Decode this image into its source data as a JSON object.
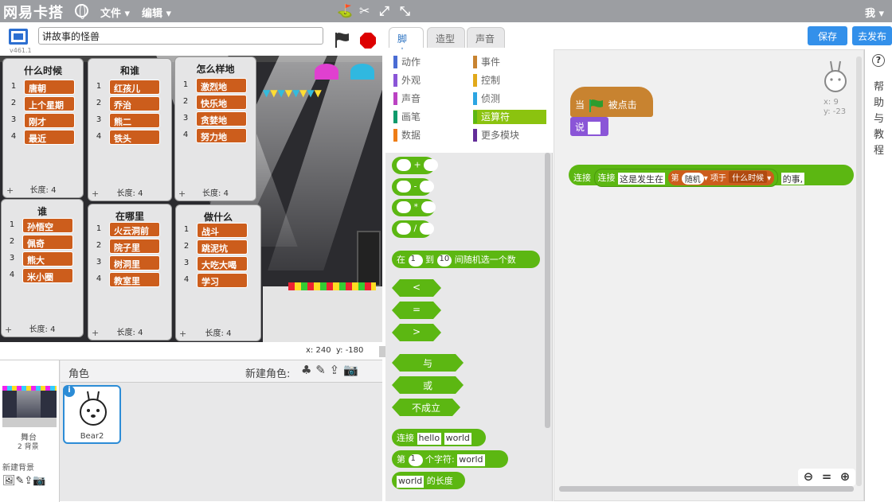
{
  "app": {
    "logo": "网易卡搭",
    "menu_file": "文件",
    "menu_edit": "编辑",
    "user": "我"
  },
  "stage": {
    "version": "v461.1",
    "project_title": "讲故事的怪兽",
    "coords_x_label": "x:",
    "coords_x": "240",
    "coords_y_label": "y:",
    "coords_y": "-180"
  },
  "lists": [
    {
      "title": "什么时候",
      "items": [
        "唐朝",
        "上个星期",
        "刚才",
        "最近"
      ],
      "length_label": "长度: 4"
    },
    {
      "title": "和谁",
      "items": [
        "红孩儿",
        "乔治",
        "熊二",
        "铁头"
      ],
      "length_label": "长度: 4"
    },
    {
      "title": "怎么样地",
      "items": [
        "激烈地",
        "快乐地",
        "贪婪地",
        "努力地"
      ],
      "length_label": "长度: 4"
    },
    {
      "title": "谁",
      "items": [
        "孙悟空",
        "佩奇",
        "熊大",
        "米小圈"
      ],
      "length_label": "长度: 4"
    },
    {
      "title": "在哪里",
      "items": [
        "火云洞前",
        "院子里",
        "树洞里",
        "教室里"
      ],
      "length_label": "长度: 4"
    },
    {
      "title": "做什么",
      "items": [
        "战斗",
        "跳泥坑",
        "大吃大喝",
        "学习"
      ],
      "length_label": "长度: 4"
    }
  ],
  "sprites_pane": {
    "stage_label": "舞台",
    "backdrops": "2 背景",
    "new_backdrop": "新建背景",
    "header": "角色",
    "new_sprite": "新建角色:",
    "sprite_name": "Bear2"
  },
  "tabs": {
    "scripts": "脚本",
    "costumes": "造型",
    "sounds": "声音"
  },
  "buttons": {
    "save": "保存",
    "publish": "去发布"
  },
  "categories": [
    {
      "label": "动作",
      "color": "#4a6cd4"
    },
    {
      "label": "事件",
      "color": "#c88330"
    },
    {
      "label": "外观",
      "color": "#8a55d7"
    },
    {
      "label": "控制",
      "color": "#e1a91a"
    },
    {
      "label": "声音",
      "color": "#bb42c3"
    },
    {
      "label": "侦测",
      "color": "#2ca5e2"
    },
    {
      "label": "画笔",
      "color": "#0e9a6c"
    },
    {
      "label": "运算符",
      "color": "#5cb712"
    },
    {
      "label": "数据",
      "color": "#ee7d16"
    },
    {
      "label": "更多模块",
      "color": "#632d99"
    }
  ],
  "blocks": {
    "plus": "+",
    "minus": "-",
    "times": "*",
    "divide": "/",
    "random_pre": "在",
    "random_from": "1",
    "random_to_word": "到",
    "random_to": "10",
    "random_post": "间随机选一个数",
    "lt": "<",
    "eq": "=",
    "gt": ">",
    "and": "与",
    "or": "或",
    "not": "不成立",
    "join": "连接",
    "join_a": "hello",
    "join_b": "world",
    "letter_pre": "第",
    "letter_n": "1",
    "letter_mid": "个字符:",
    "letter_str": "world",
    "length_str": "world",
    "length_post": "的长度"
  },
  "script": {
    "hat_when": "当",
    "hat_clicked": "被点击",
    "say": "说",
    "join": "连接",
    "join2": "连接",
    "text1": "这是发生在",
    "item_pre": "第",
    "item_random": "随机",
    "item_mid": "项于",
    "item_list": "什么时候",
    "text2": "的事,",
    "sprite_x": "x: 9",
    "sprite_y": "y: -23"
  },
  "help": {
    "text": "帮助与教程",
    "icon": "?"
  }
}
